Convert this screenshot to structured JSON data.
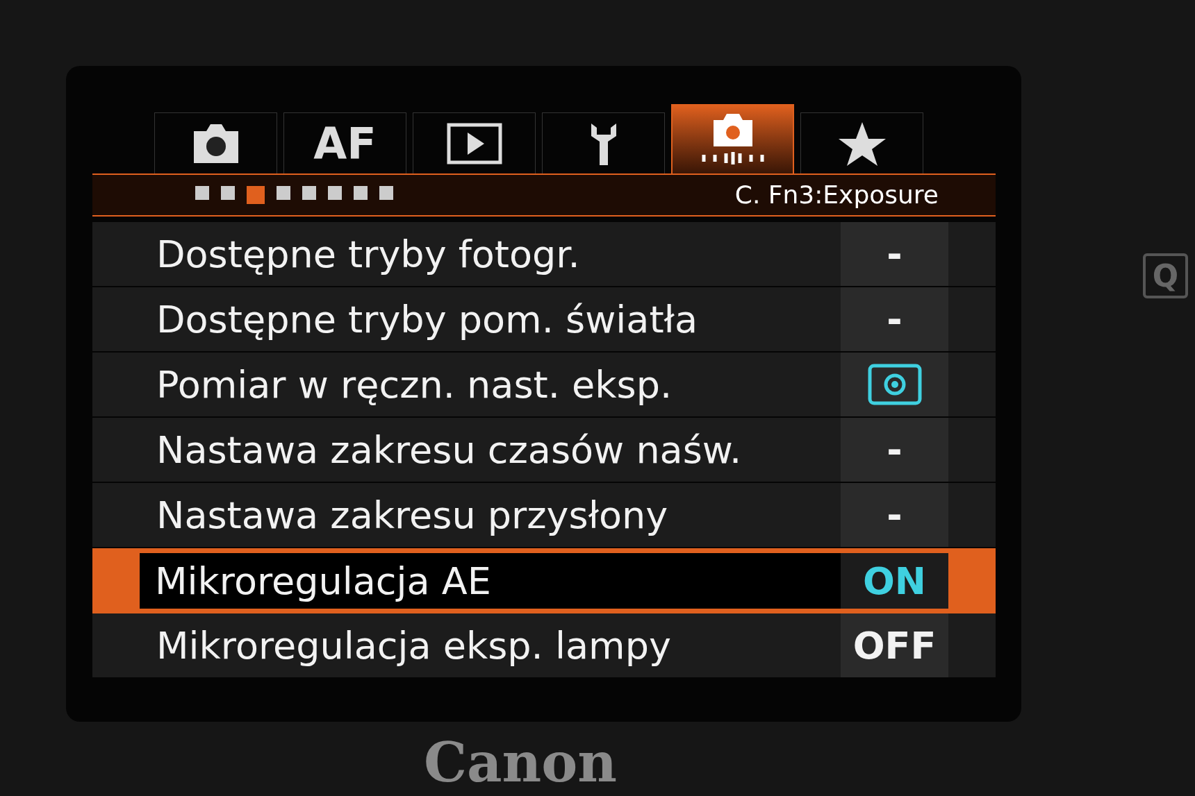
{
  "tabs": [
    {
      "kind": "camera",
      "selected": false
    },
    {
      "kind": "text",
      "label": "AF",
      "selected": false
    },
    {
      "kind": "play",
      "selected": false
    },
    {
      "kind": "wrench",
      "selected": false
    },
    {
      "kind": "custom",
      "selected": true
    },
    {
      "kind": "star",
      "selected": false
    }
  ],
  "page_indicator": [
    {
      "selected": false
    },
    {
      "selected": false
    },
    {
      "selected": true
    },
    {
      "selected": false
    },
    {
      "selected": false
    },
    {
      "selected": false
    },
    {
      "selected": false
    },
    {
      "selected": false
    }
  ],
  "section_title": "C. Fn3:Exposure",
  "rows": [
    {
      "label": "Dostępne tryby fotogr.",
      "kind": "text",
      "value": "-",
      "accent": false,
      "selected": false
    },
    {
      "label": "Dostępne tryby pom. światła",
      "kind": "text",
      "value": "-",
      "accent": false,
      "selected": false
    },
    {
      "label": "Pomiar w ręczn. nast. eksp.",
      "kind": "metering",
      "accent": true,
      "selected": false
    },
    {
      "label": "Nastawa zakresu czasów naśw.",
      "kind": "text",
      "value": "-",
      "accent": false,
      "selected": false
    },
    {
      "label": "Nastawa zakresu przysłony",
      "kind": "text",
      "value": "-",
      "accent": false,
      "selected": false
    },
    {
      "label": "Mikroregulacja AE",
      "kind": "text",
      "value": "ON",
      "accent": true,
      "selected": true
    },
    {
      "label": "Mikroregulacja eksp. lampy",
      "kind": "text",
      "value": "OFF",
      "accent": false,
      "selected": false
    }
  ],
  "body": {
    "button_label": "Q",
    "brand": "Canon"
  }
}
